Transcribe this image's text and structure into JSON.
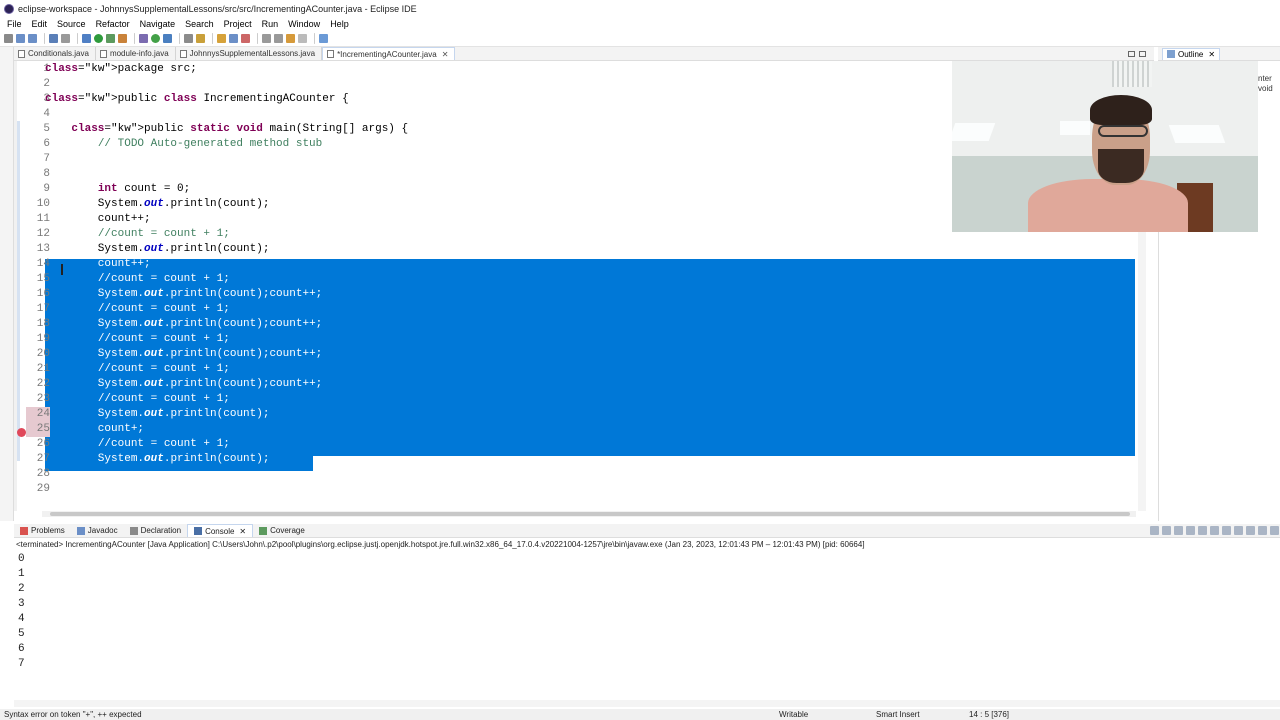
{
  "window": {
    "title": "eclipse-workspace - JohnnysSupplementalLessons/src/src/IncrementingACounter.java - Eclipse IDE"
  },
  "menu": [
    "File",
    "Edit",
    "Source",
    "Refactor",
    "Navigate",
    "Search",
    "Project",
    "Run",
    "Window",
    "Help"
  ],
  "editor_tabs": [
    {
      "label": "Conditionals.java"
    },
    {
      "label": "module-info.java"
    },
    {
      "label": "JohnnysSupplementalLessons.java"
    },
    {
      "label": "*IncrementingACounter.java",
      "active": true
    }
  ],
  "outline": {
    "tab_label": "Outline",
    "partial_text_1": "nter",
    "partial_text_2": "void"
  },
  "code_lines": [
    "package src;",
    "",
    "public class IncrementingACounter {",
    "",
    "    public static void main(String[] args) {",
    "        // TODO Auto-generated method stub",
    "",
    "",
    "        int count = 0;",
    "        System.out.println(count);",
    "        count++;",
    "        //count = count + 1;",
    "        System.out.println(count);",
    "        count++;",
    "        //count = count + 1;",
    "        System.out.println(count);count++;",
    "        //count = count + 1;",
    "        System.out.println(count);count++;",
    "        //count = count + 1;",
    "        System.out.println(count);count++;",
    "        //count = count + 1;",
    "        System.out.println(count);count++;",
    "        //count = count + 1;",
    "        System.out.println(count);",
    "        count+;",
    "        //count = count + 1;",
    "        System.out.println(count);",
    "",
    ""
  ],
  "selection": {
    "from_line": 14,
    "to_line": 27
  },
  "console": {
    "tabs": [
      "Problems",
      "Javadoc",
      "Declaration",
      "Console",
      "Coverage"
    ],
    "active_tab": "Console",
    "header": "<terminated> IncrementingACounter [Java Application] C:\\Users\\John\\.p2\\pool\\plugins\\org.eclipse.justj.openjdk.hotspot.jre.full.win32.x86_64_17.0.4.v20221004-1257\\jre\\bin\\javaw.exe  (Jan 23, 2023, 12:01:43 PM – 12:01:43 PM) [pid: 60664]",
    "output": [
      "0",
      "1",
      "2",
      "3",
      "4",
      "5",
      "6",
      "7"
    ]
  },
  "status": {
    "message": "Syntax error on token \"+\", ++ expected",
    "writable": "Writable",
    "insert_mode": "Smart Insert",
    "position": "14 : 5 [376]"
  },
  "colors": {
    "selection": "#0078d7",
    "keyword": "#7f0055",
    "comment": "#3f7f5f",
    "field": "#0000c0"
  }
}
